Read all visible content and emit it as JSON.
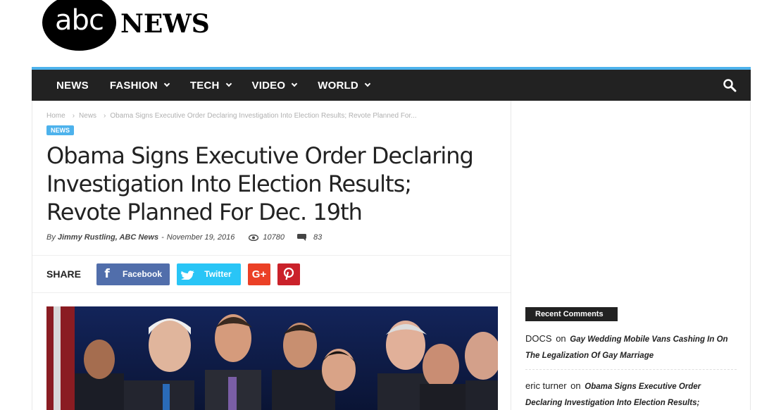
{
  "logo": {
    "abc": "abc",
    "news": "NEWS"
  },
  "nav": {
    "items": [
      {
        "label": "NEWS",
        "dropdown": false
      },
      {
        "label": "FASHION",
        "dropdown": true
      },
      {
        "label": "TECH",
        "dropdown": true
      },
      {
        "label": "VIDEO",
        "dropdown": true
      },
      {
        "label": "WORLD",
        "dropdown": true
      }
    ],
    "search_icon": "search-icon"
  },
  "breadcrumb": {
    "home": "Home",
    "section": "News",
    "current": "Obama Signs Executive Order Declaring Investigation Into Election Results; Revote Planned For..."
  },
  "article": {
    "category": "NEWS",
    "title": "Obama Signs Executive Order Declaring Investigation Into Election Results; Revote Planned For Dec. 19th",
    "by": "By",
    "author": "Jimmy Rustling, ABC News",
    "date_sep": "-",
    "date": "November 19, 2016",
    "views": "10780",
    "comments": "83"
  },
  "share": {
    "label": "SHARE",
    "facebook": "Facebook",
    "twitter": "Twitter",
    "googleplus": "G+"
  },
  "sidebar": {
    "recent_comments_title": "Recent Comments",
    "comments": [
      {
        "author": "DOCS",
        "on": "on",
        "post": "Gay Wedding Mobile Vans Cashing In On The Legalization Of Gay Marriage"
      },
      {
        "author": "eric turner",
        "on": "on",
        "post": "Obama Signs Executive Order Declaring Investigation Into Election Results;"
      }
    ]
  },
  "colors": {
    "accent": "#4db2ec",
    "nav_bg": "#222222",
    "facebook": "#516eab",
    "twitter": "#29c5f6",
    "googleplus": "#eb4026",
    "pinterest": "#ca212a"
  }
}
